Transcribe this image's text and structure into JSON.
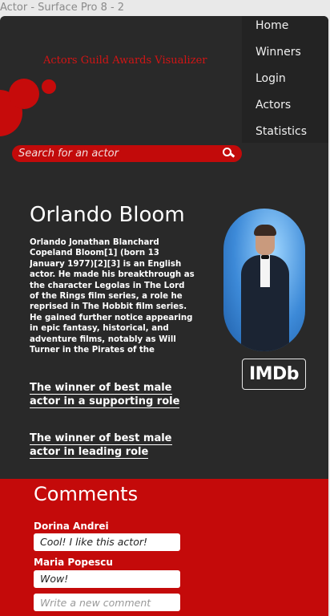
{
  "window": {
    "title": "Actor - Surface Pro 8 - 2"
  },
  "app": {
    "title": "Actors Guild Awards Visualizer"
  },
  "nav": {
    "items": [
      {
        "label": "Home"
      },
      {
        "label": "Winners"
      },
      {
        "label": "Login"
      },
      {
        "label": "Actors"
      },
      {
        "label": "Statistics"
      }
    ]
  },
  "search": {
    "placeholder": "Search for an actor",
    "icon": "search-icon"
  },
  "actor": {
    "name": "Orlando Bloom",
    "bio": "Orlando Jonathan Blanchard Copeland Bloom[1] (born 13 January 1977)[2][3] is an English actor. He made his breakthrough as the character Legolas in The Lord of the Rings film series, a role he reprised in The Hobbit film series. He gained further notice appearing in epic fantasy, historical, and adventure films, notably as Will Turner in the Pirates of the",
    "imdb_label": "IMDb",
    "awards": [
      {
        "label": "The winner of best male actor in a supporting role"
      },
      {
        "label": "The winner of best male actor in leading role"
      }
    ]
  },
  "comments": {
    "title": "Comments",
    "items": [
      {
        "author": "Dorina Andrei",
        "text": "Cool! I like this actor!"
      },
      {
        "author": "Maria Popescu",
        "text": "Wow!"
      }
    ],
    "new_placeholder": "Write a new comment"
  },
  "colors": {
    "accent": "#c40a0a",
    "background": "#292929",
    "title_red": "#d11515"
  }
}
